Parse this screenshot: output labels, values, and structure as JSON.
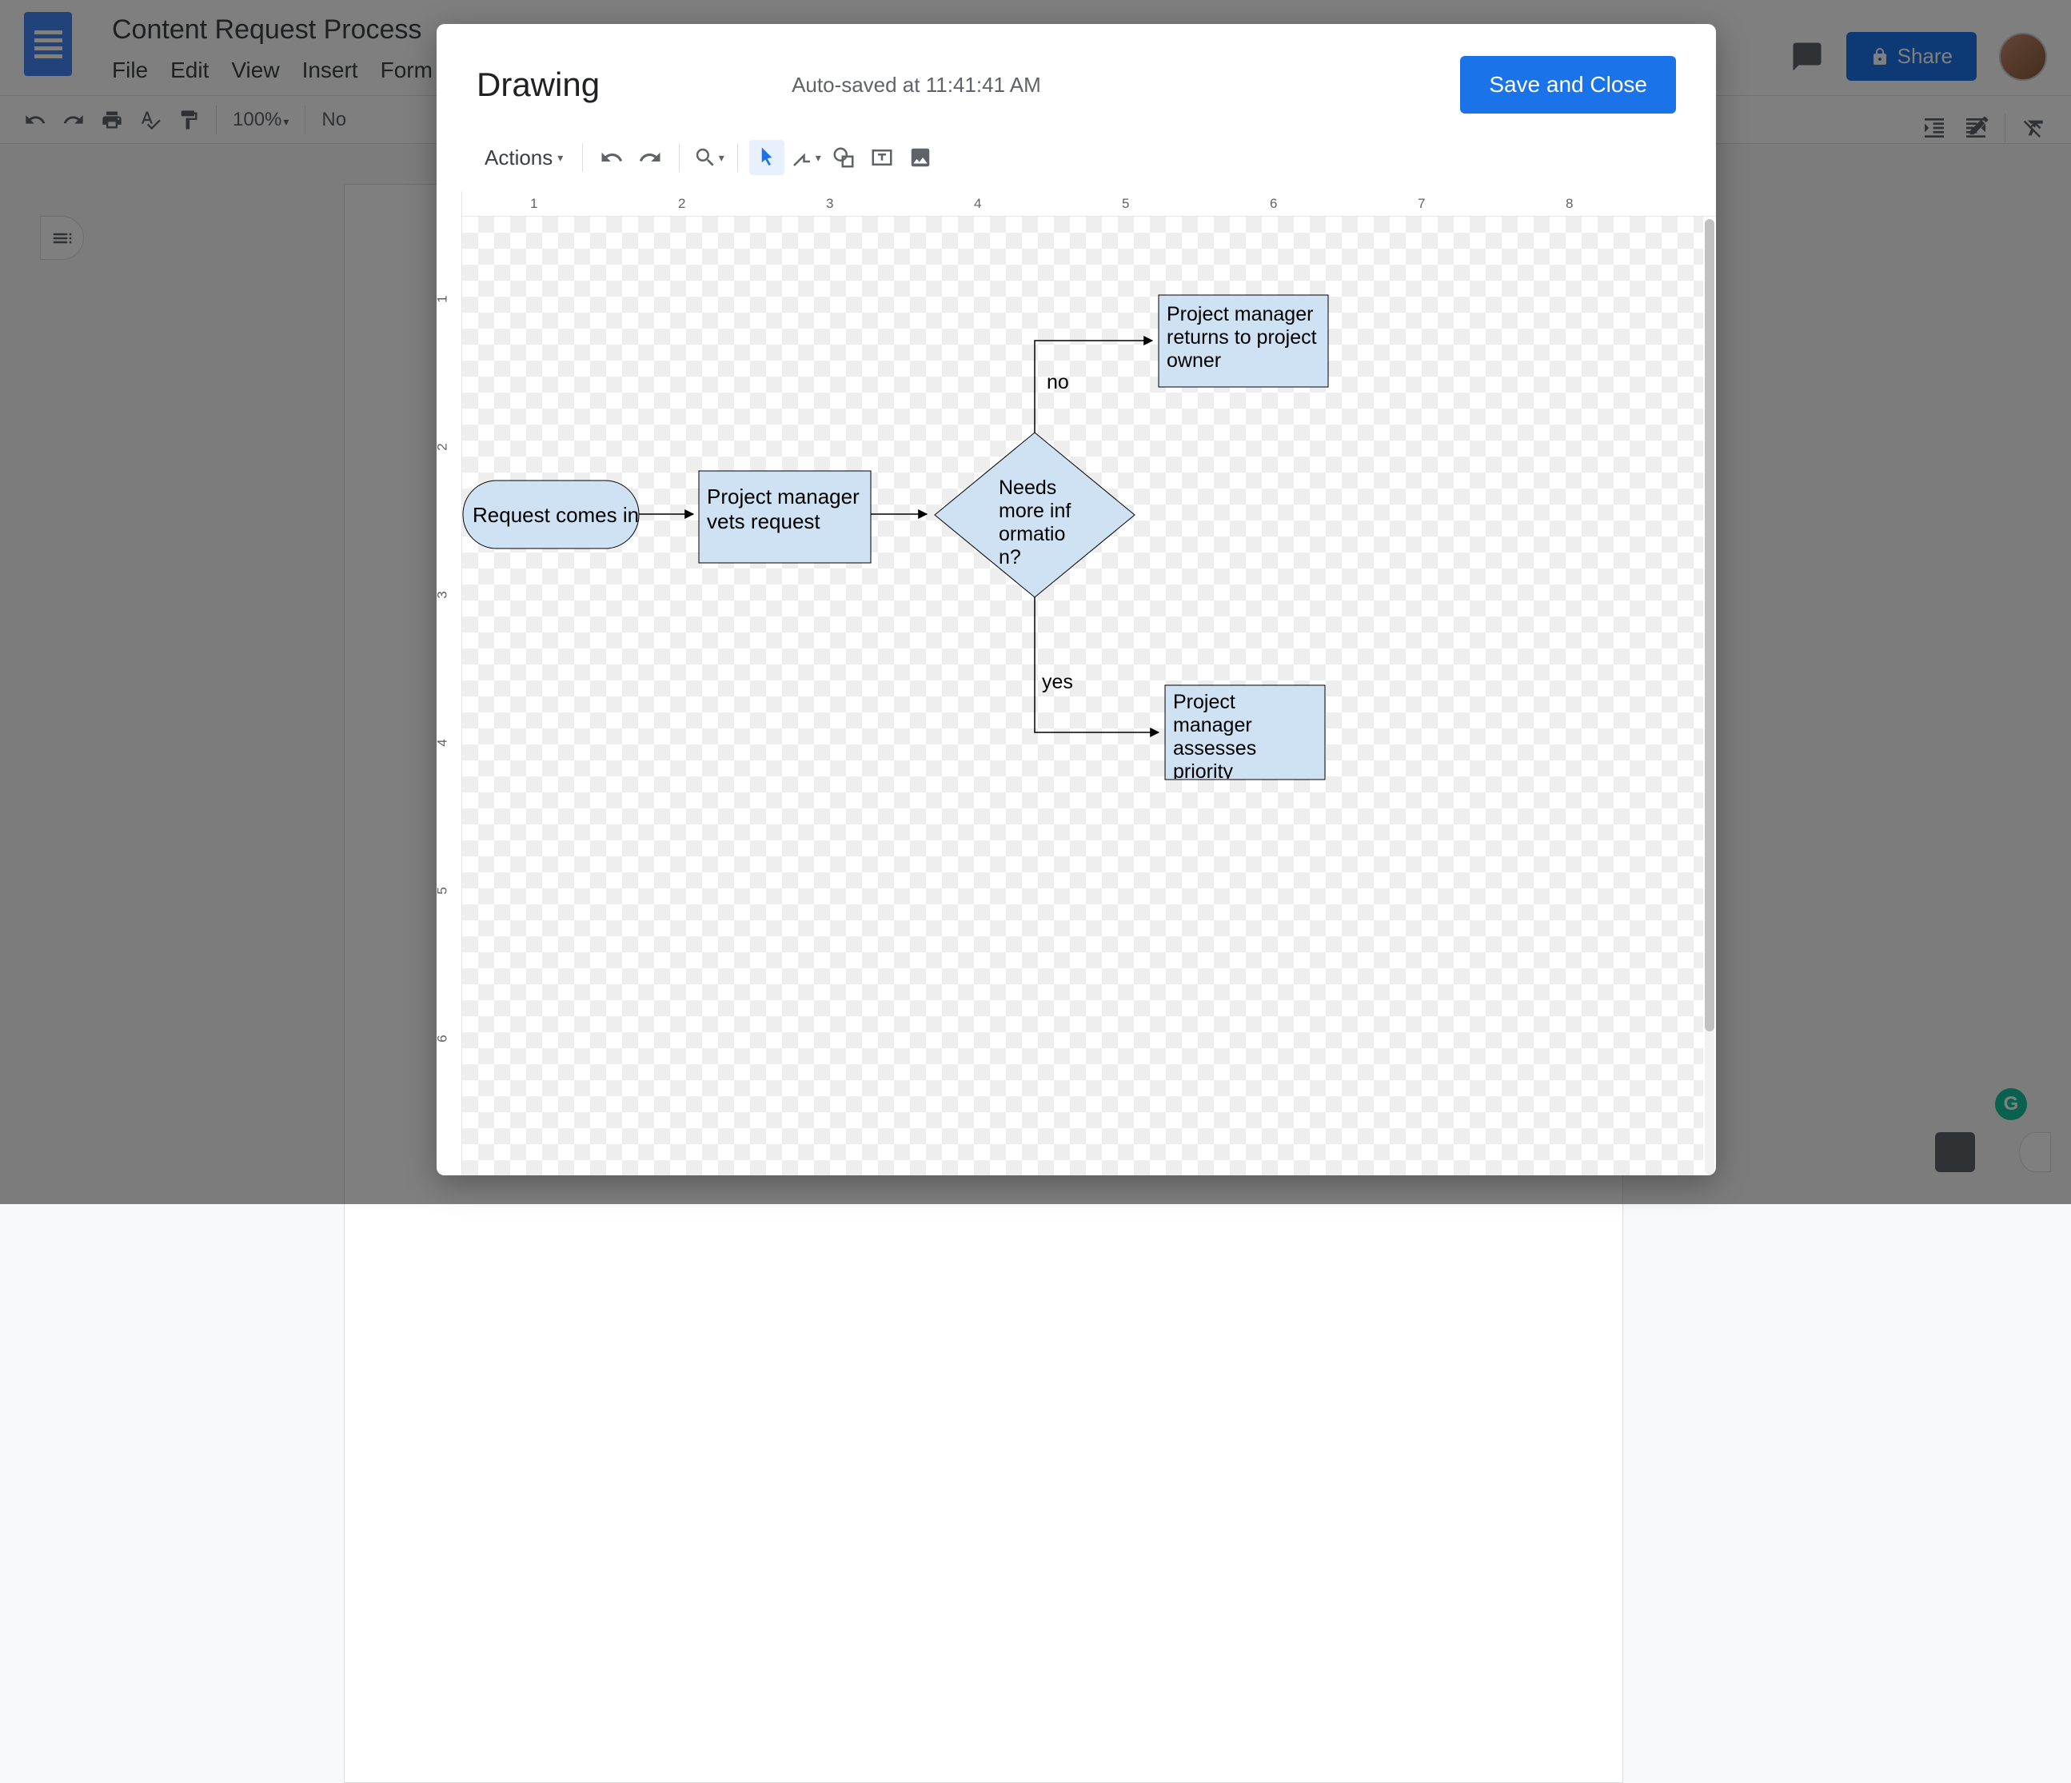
{
  "docs": {
    "title": "Content Request Process",
    "menus": [
      "File",
      "Edit",
      "View",
      "Insert",
      "Form"
    ],
    "share_label": "Share",
    "zoom": "100%",
    "style": "No"
  },
  "modal": {
    "title": "Drawing",
    "autosave": "Auto-saved at 11:41:41 AM",
    "save_close": "Save and Close",
    "actions_label": "Actions",
    "hruler": [
      "1",
      "2",
      "3",
      "4",
      "5",
      "6",
      "7",
      "8"
    ],
    "vruler": [
      "1",
      "2",
      "3",
      "4",
      "5",
      "6"
    ]
  },
  "flowchart": {
    "nodes": {
      "start": "Request comes in",
      "vet": "Project manager vets request",
      "decision": "Needs more information?",
      "return": "Project manager returns to project owner",
      "assess": "Project manager assesses priority"
    },
    "labels": {
      "no": "no",
      "yes": "yes"
    }
  }
}
